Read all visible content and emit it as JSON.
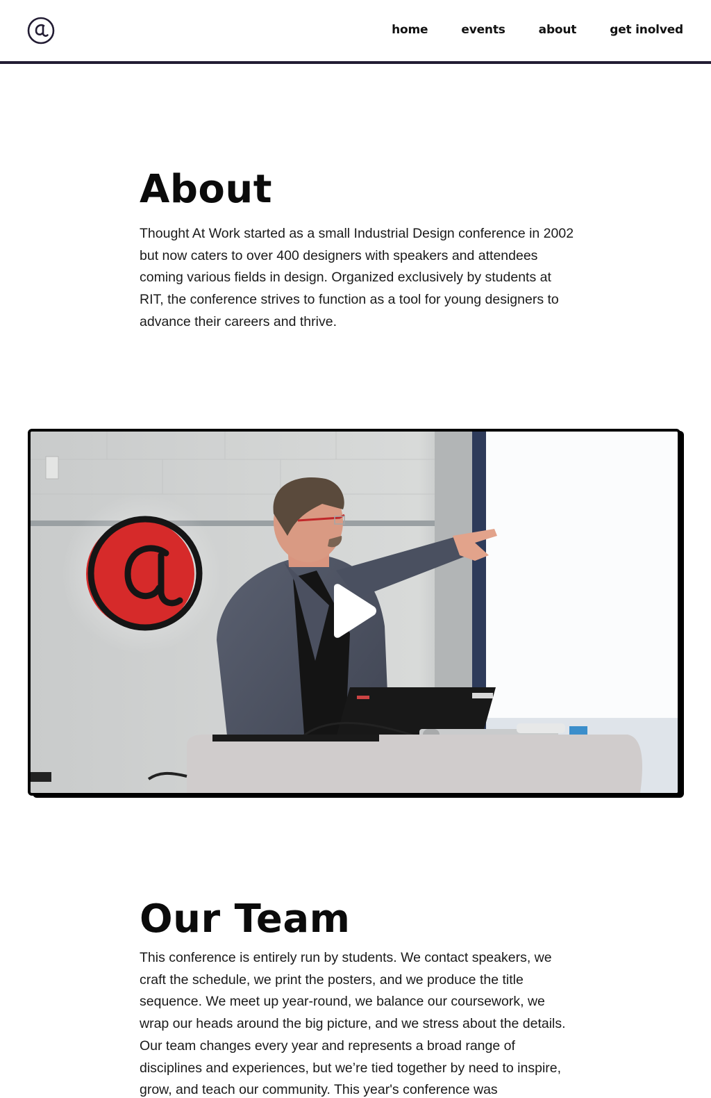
{
  "header": {
    "logo_icon": "at-sign-logo-icon",
    "nav": [
      {
        "label": "home"
      },
      {
        "label": "events"
      },
      {
        "label": "about"
      },
      {
        "label": "get inolved"
      }
    ],
    "border_color": "#221c33"
  },
  "about": {
    "title": "About",
    "paragraph": "Thought At Work started as a small Industrial Design conference in 2002 but now caters to over 400 designers with speakers and attendees coming various fields in design. Organized exclusively by students at RIT, the conference strives to function as a tool for young designers to advance their careers and thrive."
  },
  "video": {
    "play_icon": "play-icon",
    "logo_color": "#d62a2a"
  },
  "team": {
    "title": "Our Team",
    "paragraph": "This conference is entirely run by students. We contact speakers, we craft the schedule, we print the posters, and we produce the title sequence. We meet up year-round, we balance our coursework, we wrap our heads around the big picture, and we stress about the details. Our team changes every year and represents a broad range of disciplines and experiences, but we’re tied together by need to inspire, grow, and teach our community. This year's conference was"
  }
}
